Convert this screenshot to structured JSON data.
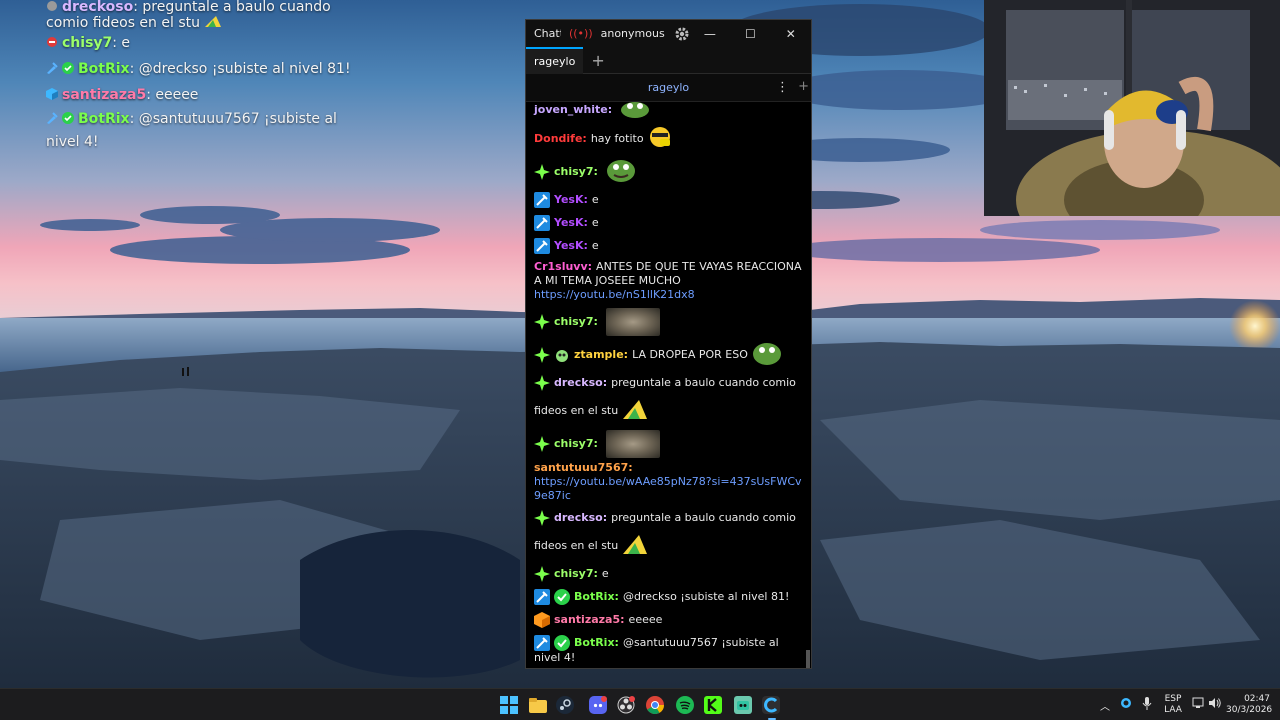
{
  "overlay": [
    {
      "icon": "gray-dot-badge-icon",
      "user": "drecko",
      "user_suffix": "so",
      "user_color": "#d8b8ff",
      "text": ": preguntale a baulo cuando comio fideos en el stu"
    },
    {
      "icon": "red-dot-badge-icon",
      "user": "chisy7",
      "user_color": "#9cff6a",
      "text": ": e"
    },
    {
      "icon": "moderator-badge-icon",
      "user": "BotRix",
      "user_color": "#7bff4c",
      "text": ": @dreckso ¡subiste al nivel 81!"
    },
    {
      "icon": "cube-badge-icon",
      "user": "santizaza",
      "user_suffix": "5",
      "user_color": "#ff7aa8",
      "text": ": eeeee"
    },
    {
      "icon": "moderator-badge-icon",
      "user": "BotRix",
      "user_color": "#7bff4c",
      "text": ": @santutuuu7567 ¡subiste al nivel 4!"
    }
  ],
  "window": {
    "app_title": "Chatterino",
    "account": "anonymous",
    "tab": "rageylo",
    "add_tab": "+",
    "channel": "rageylo",
    "menu": "⋮",
    "add_split": "+",
    "minimize": "—",
    "maximize": "☐",
    "close": "✕"
  },
  "messages": [
    {
      "user": "joven_white:",
      "color": "#c7a7ff",
      "text": ""
    },
    {
      "user": "Dondife:",
      "color": "#ff3b3b",
      "text": "hay fotito"
    },
    {
      "user": "chisy7:",
      "color": "#9cff6a",
      "text": ""
    },
    {
      "user": "YesK:",
      "color": "#b24dff",
      "text": "e"
    },
    {
      "user": "YesK:",
      "color": "#b24dff",
      "text": "e"
    },
    {
      "user": "YesK:",
      "color": "#b24dff",
      "text": "e"
    },
    {
      "user": "Cr1sluvv:",
      "color": "#ff5fd2",
      "text": "ANTES DE QUE TE VAYAS REACCIONA A MI TEMA JOSEEE MUCHO",
      "link": "https://youtu.be/nS1llK21dx8"
    },
    {
      "user": "chisy7:",
      "color": "#9cff6a",
      "text": ""
    },
    {
      "user": "ztample:",
      "color": "#ffd23f",
      "text": "LA DROPEA POR ESO"
    },
    {
      "user": "dreckso:",
      "color": "#d8b8ff",
      "text": "preguntale a baulo cuando comio",
      "text2": "fideos en el stu"
    },
    {
      "user": "chisy7:",
      "color": "#9cff6a",
      "text": ""
    },
    {
      "user": "santutuuu7567:",
      "color": "#ffa24a",
      "text": "",
      "link": "https://youtu.be/wAAe85pNz78?si=437sUsFWCv9e87ic"
    },
    {
      "user": "dreckso:",
      "color": "#d8b8ff",
      "text": "preguntale a baulo cuando comio",
      "text2": "fideos en el stu"
    },
    {
      "user": "chisy7:",
      "color": "#9cff6a",
      "text": "e"
    },
    {
      "user": "BotRix:",
      "color": "#7bff4c",
      "text": "@dreckso ¡subiste al nivel 81!"
    },
    {
      "user": "santizaza5:",
      "color": "#ff7aa8",
      "text": "eeeee"
    },
    {
      "user": "BotRix:",
      "color": "#7bff4c",
      "text": "@santutuuu7567 ¡subiste al nivel 4!"
    }
  ],
  "taskbar": {
    "apps": [
      "windows-start-icon",
      "file-explorer-icon",
      "steam-icon",
      "discord-icon",
      "obs-icon",
      "chrome-icon",
      "spotify-icon",
      "kick-icon",
      "streamlabs-icon",
      "chatterino-icon"
    ],
    "lang_top": "ESP",
    "lang_bottom": "LAA",
    "time": "02:47",
    "date": "30/3/2026"
  }
}
